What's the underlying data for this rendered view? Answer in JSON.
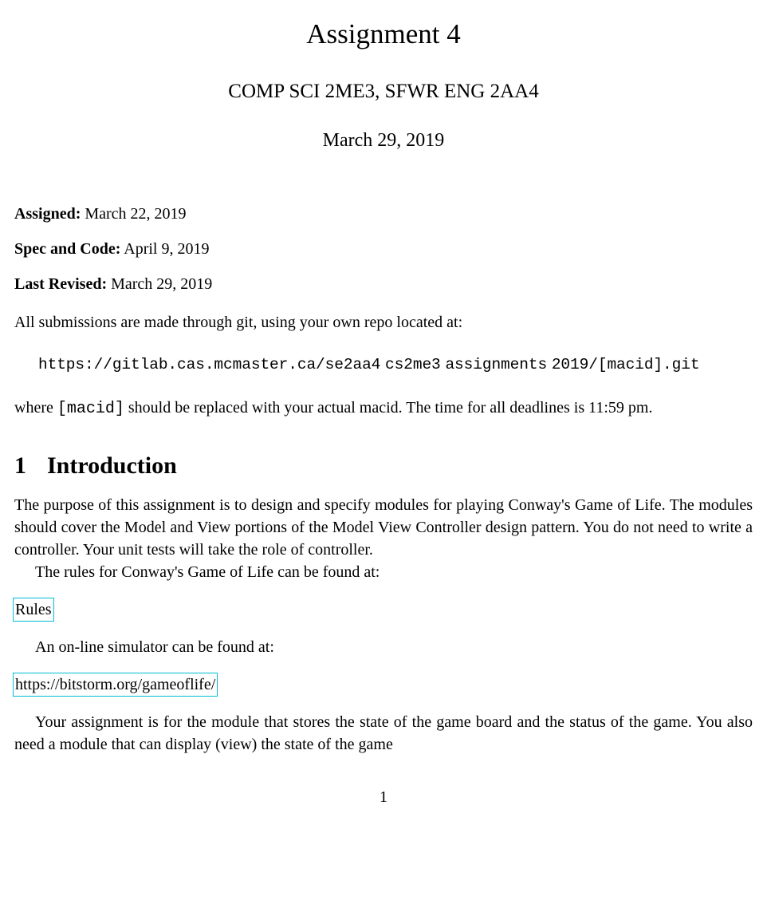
{
  "header": {
    "title": "Assignment 4",
    "subtitle": "COMP SCI 2ME3, SFWR ENG 2AA4",
    "date": "March 29, 2019"
  },
  "meta": {
    "assigned_label": "Assigned:",
    "assigned_value": "March 22, 2019",
    "spec_label": "Spec and Code:",
    "spec_value": "April 9, 2019",
    "revised_label": "Last Revised:",
    "revised_value": "March 29, 2019"
  },
  "submission": {
    "intro": "All submissions are made through git, using your own repo located at:",
    "url_prefix": "https://gitlab.cas.mcmaster.ca/se2aa4",
    "url_mid1": "cs2me3",
    "url_mid2": "assignments",
    "url_suffix": "2019/[macid].git",
    "where_prefix": "where ",
    "macid_token": "[macid]",
    "where_suffix": " should be replaced with your actual macid. The time for all deadlines is 11:59 pm."
  },
  "section": {
    "number": "1",
    "title": "Introduction",
    "para1": "The purpose of this assignment is to design and specify modules for playing Conway's Game of Life. The modules should cover the Model and View portions of the Model View Controller design pattern. You do not need to write a controller. Your unit tests will take the role of controller.",
    "para2": "The rules for Conway's Game of Life can be found at:",
    "rules_link": "Rules",
    "para3": "An on-line simulator can be found at:",
    "sim_link": "https://bitstorm.org/gameoflife/",
    "para4": "Your assignment is for the module that stores the state of the game board and the status of the game. You also need a module that can display (view) the state of the game"
  },
  "page_number": "1"
}
